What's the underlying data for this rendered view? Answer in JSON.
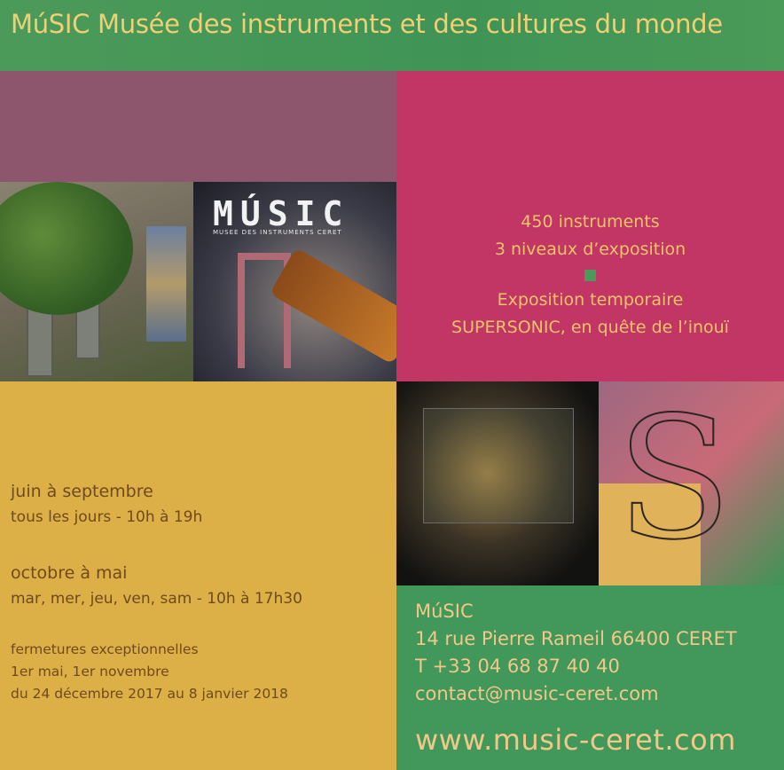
{
  "header": {
    "title": "MúSIC Musée des instruments et des cultures du monde"
  },
  "logo": {
    "main": "MÚSIC",
    "sub": "MUSEE DES INSTRUMENTS CERET"
  },
  "info": {
    "line1": "450 instruments",
    "line2": "3 niveaux d’exposition",
    "line3": "Exposition temporaire",
    "line4": "SUPERSONIC, en quête de l’inouï"
  },
  "hours": {
    "summer_title": "juin à septembre",
    "summer_text": "tous les jours - 10h à 19h",
    "winter_title": "octobre à mai",
    "winter_text": "mar, mer, jeu, ven, sam - 10h à 17h30",
    "closures_title": "fermetures exceptionnelles",
    "closures_1": "1er mai, 1er novembre",
    "closures_2": "du 24 décembre 2017 au 8 janvier 2018"
  },
  "contact": {
    "name": "MúSIC",
    "address": "14 rue Pierre Rameil 66400 CERET",
    "phone": "T +33 04 68 87 40 40",
    "email": "contact@music-ceret.com",
    "website": "www.music-ceret.com"
  },
  "colors": {
    "green": "#42975a",
    "magenta": "#c13664",
    "mauve": "#8e566c",
    "ochre": "#dcb047",
    "text_gold": "#f1cf74"
  }
}
